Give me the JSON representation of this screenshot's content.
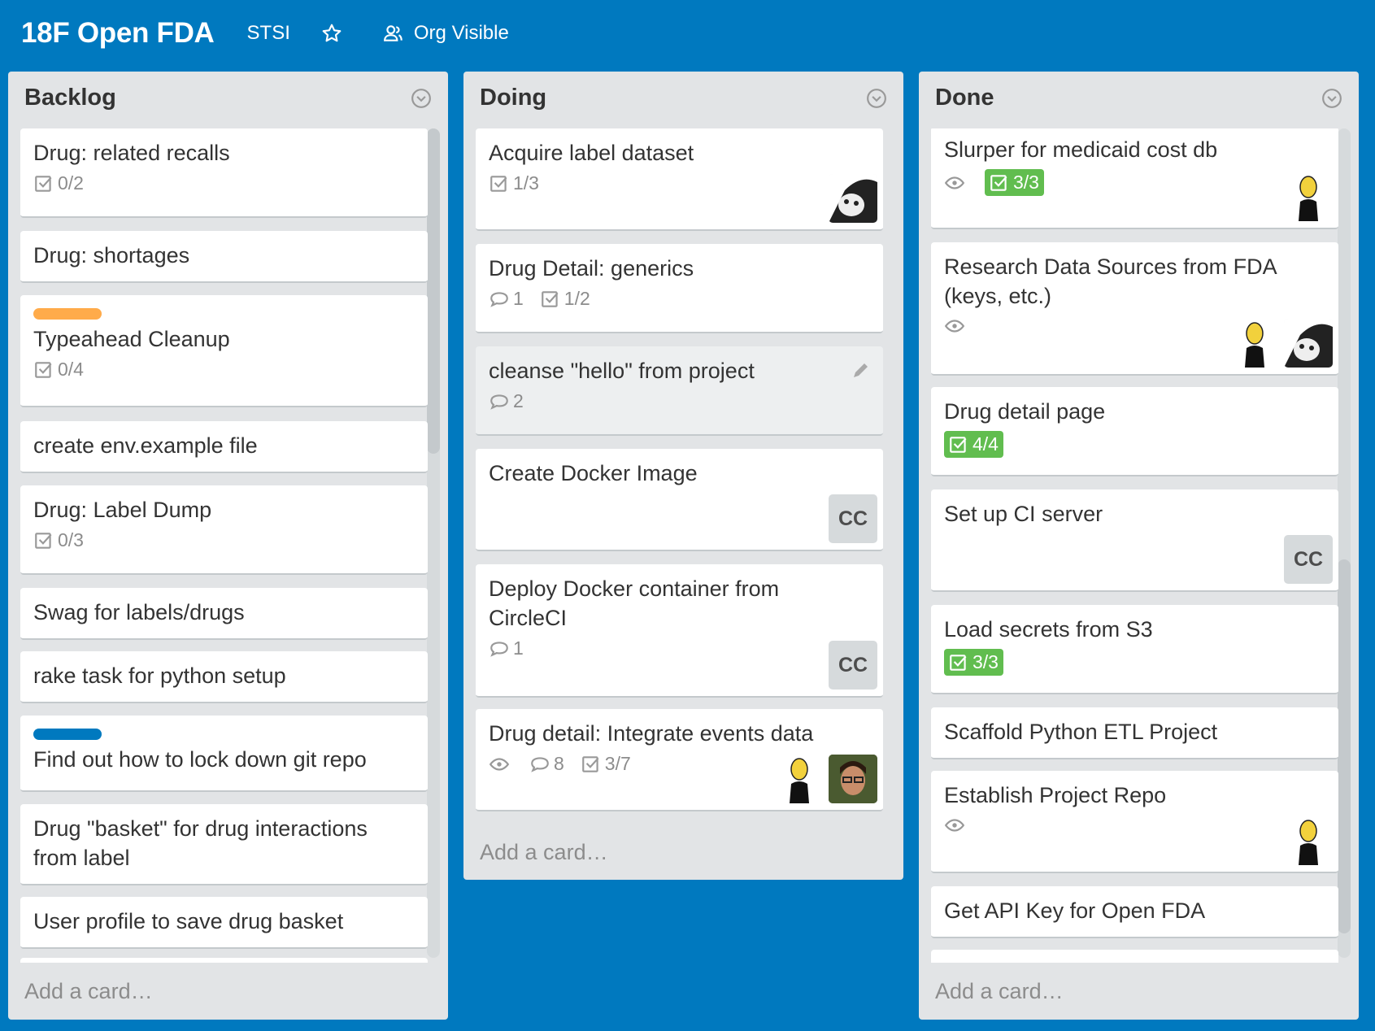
{
  "board": {
    "title": "18F Open FDA",
    "org": "STSI",
    "visibility": "Org Visible"
  },
  "lists": [
    {
      "title": "Backlog",
      "add_card": "Add a card…",
      "cards": [
        {
          "title": "Drug: related recalls",
          "checklist": "0/2"
        },
        {
          "title": "Drug: shortages"
        },
        {
          "title": "Typeahead Cleanup",
          "checklist": "0/4",
          "label_color": "#ffab4a"
        },
        {
          "title": "create env.example file"
        },
        {
          "title": "Drug: Label Dump",
          "checklist": "0/3"
        },
        {
          "title": "Swag for labels/drugs"
        },
        {
          "title": "rake task for python setup"
        },
        {
          "title": "Find out how to lock down git repo",
          "label_color": "#0079bf"
        },
        {
          "title": "Drug \"basket\" for drug interactions from label"
        },
        {
          "title": "User profile to save drug basket"
        }
      ]
    },
    {
      "title": "Doing",
      "add_card": "Add a card…",
      "cards": [
        {
          "title": "Acquire label dataset",
          "checklist": "1/3",
          "members": [
            "face-avatar"
          ]
        },
        {
          "title": "Drug Detail: generics",
          "comments": "1",
          "checklist": "1/2"
        },
        {
          "title": "cleanse \"hello\" from project",
          "comments": "2"
        },
        {
          "title": "Create Docker Image",
          "members": [
            "CC"
          ]
        },
        {
          "title": "Deploy Docker container from CircleCI",
          "comments": "1",
          "members": [
            "CC"
          ]
        },
        {
          "title": "Drug detail: Integrate events data",
          "comments": "8",
          "checklist": "3/7",
          "members": [
            "figure-avatar",
            "person-avatar"
          ]
        }
      ]
    },
    {
      "title": "Done",
      "add_card": "Add a card…",
      "cards": [
        {
          "title": "Slurper for medicaid cost db",
          "checklist": "3/3",
          "members": [
            "figure-avatar"
          ]
        },
        {
          "title": "Research Data Sources from FDA (keys, etc.)",
          "members": [
            "figure-avatar",
            "face-avatar"
          ]
        },
        {
          "title": "Drug detail page",
          "checklist": "4/4"
        },
        {
          "title": "Set up CI server",
          "members": [
            "CC"
          ]
        },
        {
          "title": "Load secrets from S3",
          "checklist": "3/3"
        },
        {
          "title": "Scaffold Python ETL Project"
        },
        {
          "title": "Establish Project Repo",
          "members": [
            "figure-avatar"
          ]
        },
        {
          "title": "Get API Key for Open FDA"
        }
      ]
    }
  ],
  "colors": {
    "board_bg": "#0079bf",
    "list_bg": "#e2e4e6",
    "complete_badge": "#61bd4f"
  }
}
